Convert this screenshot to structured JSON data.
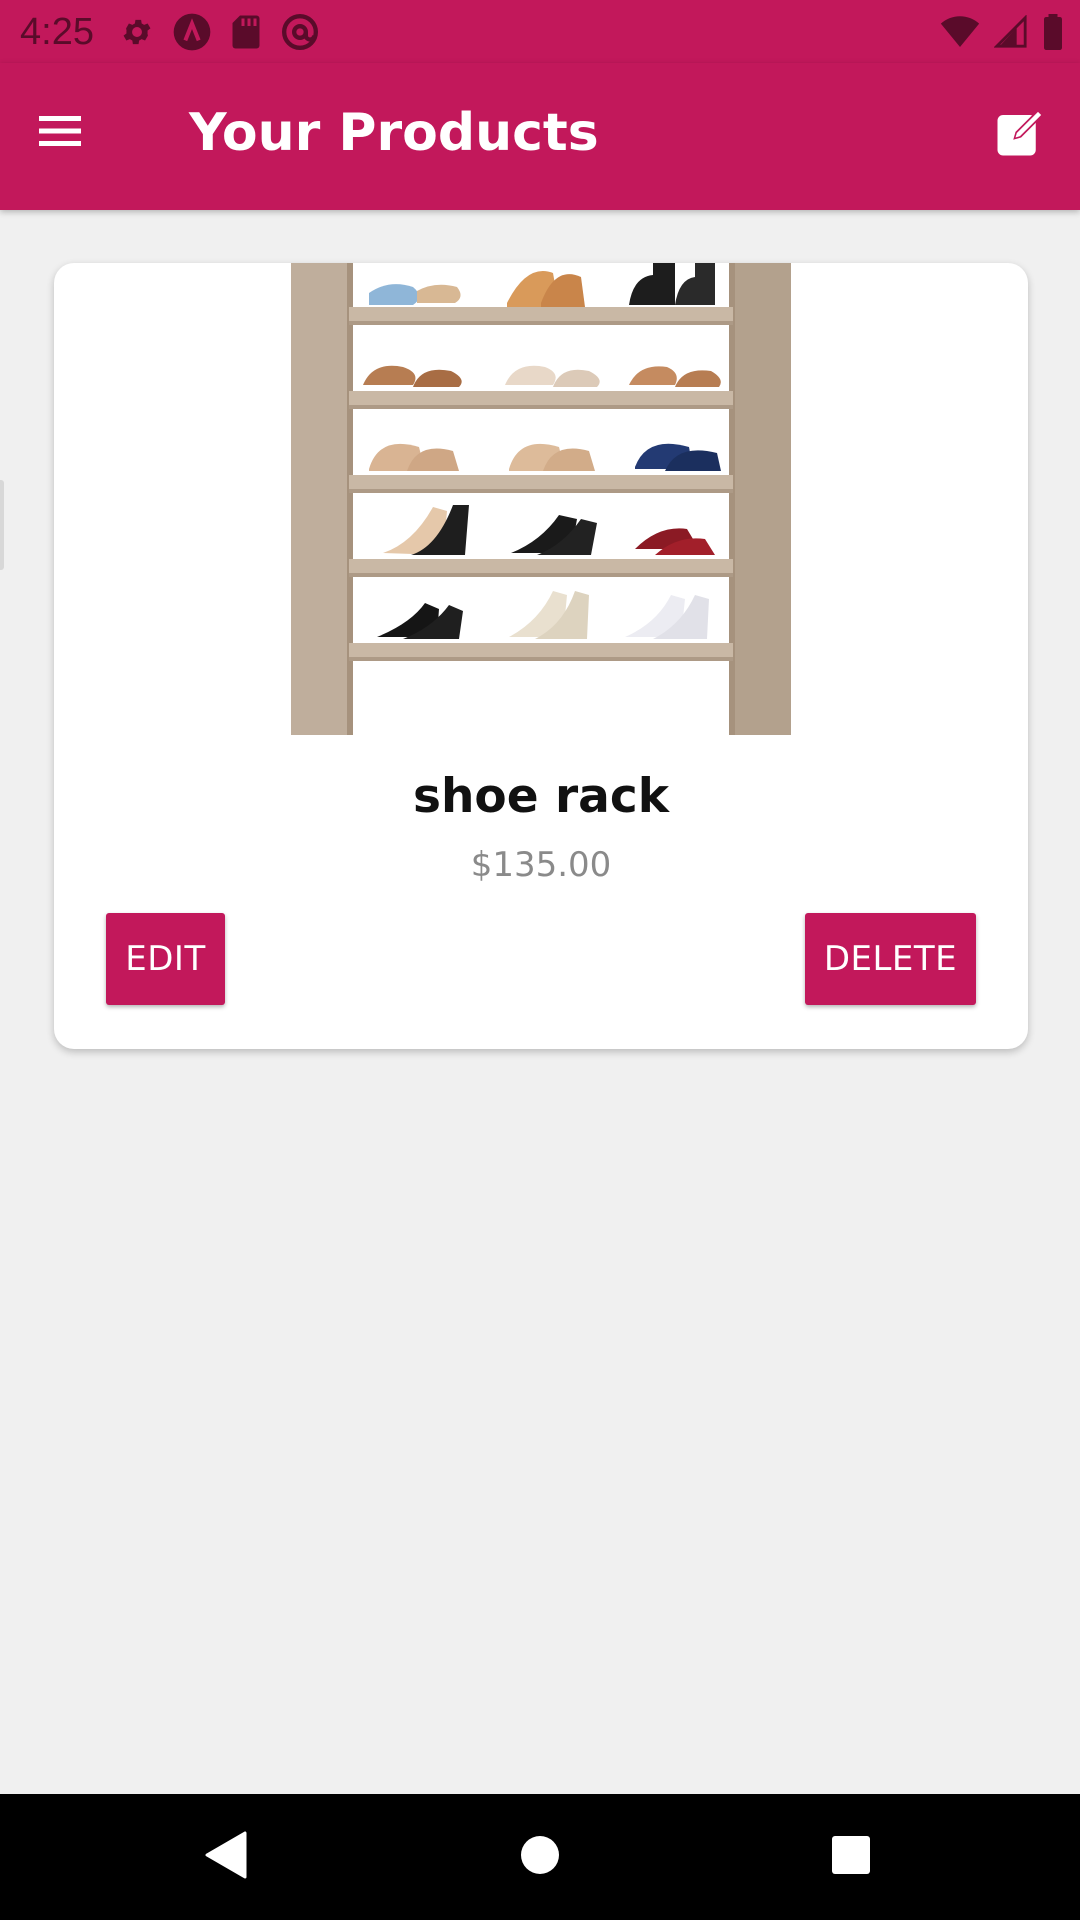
{
  "status_bar": {
    "time": "4:25",
    "icons_left": [
      "settings-gear-icon",
      "a-logo-icon",
      "sd-card-icon",
      "at-sign-icon"
    ],
    "icons_right": [
      "wifi-icon",
      "cell-signal-icon",
      "battery-icon"
    ]
  },
  "app_bar": {
    "title": "Your Products",
    "menu_icon": "hamburger-menu-icon",
    "action_icon": "edit-square-icon",
    "color": "#c2185b"
  },
  "product": {
    "title": "shoe rack",
    "price": "$135.00",
    "image_alt": "Wooden shoe rack with shoes"
  },
  "actions": {
    "edit_label": "EDIT",
    "delete_label": "DELETE"
  },
  "nav_bar": {
    "icons": [
      "back-triangle-icon",
      "home-circle-icon",
      "recents-square-icon"
    ]
  },
  "colors": {
    "primary": "#c2185b",
    "background": "#f0f0f0",
    "card": "#ffffff",
    "price_text": "#8a8a8a"
  }
}
